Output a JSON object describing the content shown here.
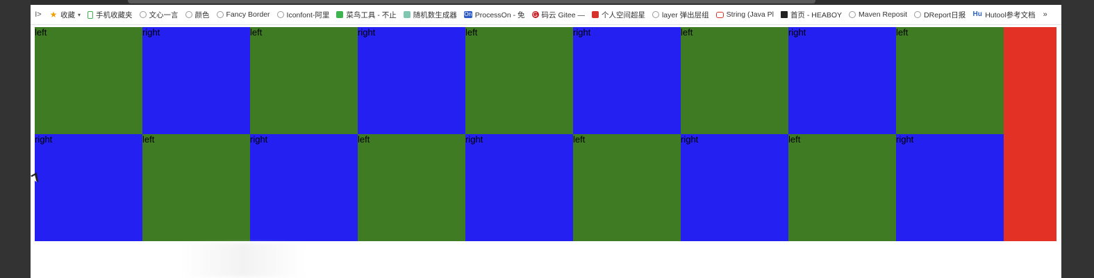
{
  "browser": {
    "bookmarks_toggle": "I>",
    "bookmarks": [
      {
        "label": "收藏",
        "icon": "star-icon",
        "has_dropdown": true
      },
      {
        "label": "手机收藏夹",
        "icon": "phone-icon"
      },
      {
        "label": "文心一言",
        "icon": "globe-icon"
      },
      {
        "label": "颜色",
        "icon": "globe-icon"
      },
      {
        "label": "Fancy Border",
        "icon": "globe-icon"
      },
      {
        "label": "Iconfont-阿里",
        "icon": "globe-icon"
      },
      {
        "label": "菜鸟工具 - 不止",
        "icon": "runoob-icon"
      },
      {
        "label": "随机数生成器",
        "icon": "generator-icon"
      },
      {
        "label": "ProcessOn - 免",
        "icon": "processon-icon"
      },
      {
        "label": "码云 Gitee —",
        "icon": "gitee-icon"
      },
      {
        "label": "个人空间超星",
        "icon": "chaoxing-icon"
      },
      {
        "label": "layer 弹出层组",
        "icon": "globe-icon"
      },
      {
        "label": "String (Java Pl",
        "icon": "java-icon"
      },
      {
        "label": "首页 - HEABOY",
        "icon": "heaboy-icon"
      },
      {
        "label": "Maven Reposit",
        "icon": "globe-icon"
      },
      {
        "label": "DReport日报",
        "icon": "globe-icon"
      },
      {
        "label": "Hutool参考文档",
        "icon": "hutool-icon"
      }
    ],
    "more": "»"
  },
  "page": {
    "rows": [
      [
        "left",
        "right",
        "left",
        "right",
        "left",
        "right",
        "left",
        "right",
        "left"
      ],
      [
        "right",
        "left",
        "right",
        "left",
        "right",
        "left",
        "right",
        "left",
        "right"
      ]
    ],
    "colors": {
      "left": "#3e7b22",
      "right": "#2420f2",
      "extra": "#e33125"
    }
  }
}
